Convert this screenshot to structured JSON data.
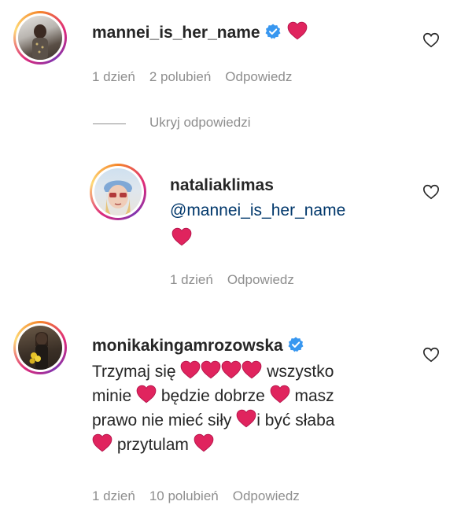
{
  "comments": [
    {
      "username": "mannei_is_her_name",
      "verified": true,
      "time": "1 dzień",
      "likes": "2 polubień",
      "reply": "Odpowiedz"
    },
    {
      "username": "nataliaklimas",
      "mention": "@mannei_is_her_name",
      "time": "1 dzień",
      "reply": "Odpowiedz"
    },
    {
      "username": "monikakingamrozowska",
      "verified": true,
      "text_parts": [
        "Trzymaj się",
        "wszystko",
        "minie",
        "będzie dobrze",
        "masz",
        "prawo nie mieć siły",
        "i być słaba",
        "przytulam"
      ],
      "time": "1 dzień",
      "likes": "10 polubień",
      "reply": "Odpowiedz"
    }
  ],
  "hide_replies_label": "Ukryj odpowiedzi",
  "colors": {
    "heart": "#e0245e",
    "verified": "#3897f0",
    "meta": "#8e8e8e",
    "mention": "#00376b"
  }
}
